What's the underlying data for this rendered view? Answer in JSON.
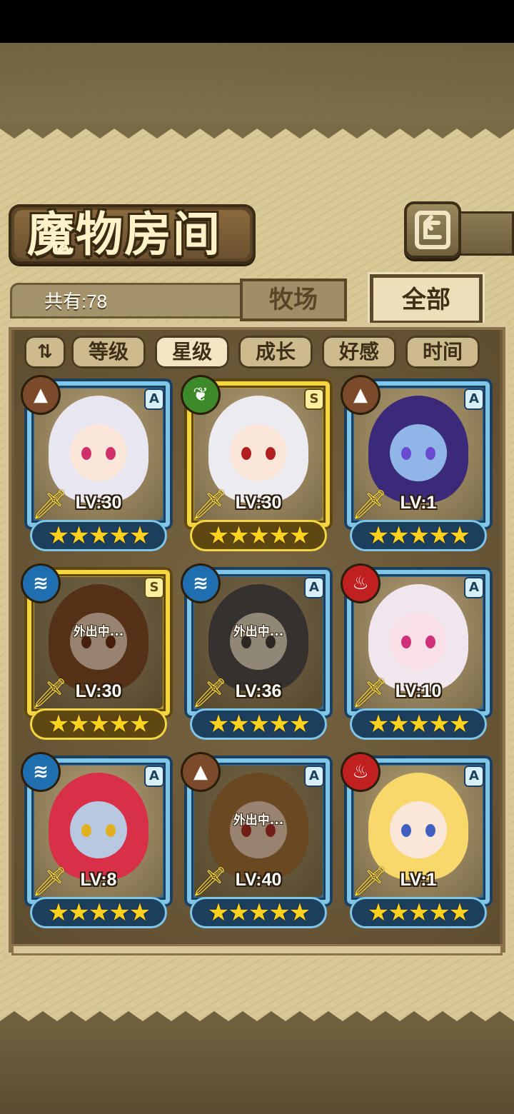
{
  "screen": {
    "title": "魔物房间",
    "count_label": "共有:78",
    "back_icon": "return-arrow-icon"
  },
  "tabs": [
    {
      "label": "牧场",
      "active": false
    },
    {
      "label": "全部",
      "active": true
    }
  ],
  "sort": {
    "toggle_glyph": "⇅",
    "buttons": [
      {
        "label": "等级",
        "active": false
      },
      {
        "label": "星级",
        "active": true
      },
      {
        "label": "成长",
        "active": false
      },
      {
        "label": "好感",
        "active": false
      },
      {
        "label": "时间",
        "active": false
      }
    ]
  },
  "monsters": [
    {
      "level": "LV:30",
      "rank": "A",
      "element": "earth",
      "element_glyph": "▲",
      "frame": "blue",
      "stars": 5,
      "status": "",
      "hair": "#e8e6f0",
      "skin": "#fbe6da",
      "eye": "#d0306a"
    },
    {
      "level": "LV:30",
      "rank": "S",
      "element": "plant",
      "element_glyph": "❦",
      "frame": "gold",
      "stars": 5,
      "status": "",
      "hair": "#ecebf0",
      "skin": "#fbe6da",
      "eye": "#b02020"
    },
    {
      "level": "LV:1",
      "rank": "A",
      "element": "earth",
      "element_glyph": "▲",
      "frame": "blue",
      "stars": 5,
      "status": "",
      "hair": "#3b2a7a",
      "skin": "#8fb6e6",
      "eye": "#6a4ad0"
    },
    {
      "level": "LV:30",
      "rank": "S",
      "element": "water",
      "element_glyph": "≋",
      "frame": "gold",
      "stars": 5,
      "status": "外出中...",
      "hair": "#7a4020",
      "skin": "#f5d6c0",
      "eye": "#602010"
    },
    {
      "level": "LV:36",
      "rank": "A",
      "element": "water",
      "element_glyph": "≋",
      "frame": "blue",
      "stars": 5,
      "status": "外出中...",
      "hair": "#404048",
      "skin": "#e8dccc",
      "eye": "#303030"
    },
    {
      "level": "LV:10",
      "rank": "A",
      "element": "fire",
      "element_glyph": "♨",
      "frame": "blue",
      "stars": 5,
      "status": "",
      "hair": "#f0e6ee",
      "skin": "#f8e0e6",
      "eye": "#d0307a"
    },
    {
      "level": "LV:8",
      "rank": "A",
      "element": "water",
      "element_glyph": "≋",
      "frame": "blue",
      "stars": 5,
      "status": "",
      "hair": "#d83048",
      "skin": "#b8c8e0",
      "eye": "#e0b020"
    },
    {
      "level": "LV:40",
      "rank": "A",
      "element": "earth",
      "element_glyph": "▲",
      "frame": "blue",
      "stars": 5,
      "status": "外出中...",
      "hair": "#a06a30",
      "skin": "#f5d6c0",
      "eye": "#b02020"
    },
    {
      "level": "LV:1",
      "rank": "A",
      "element": "fire",
      "element_glyph": "♨",
      "frame": "blue",
      "stars": 5,
      "status": "",
      "hair": "#f8d86a",
      "skin": "#fbe6da",
      "eye": "#4060c0"
    }
  ]
}
